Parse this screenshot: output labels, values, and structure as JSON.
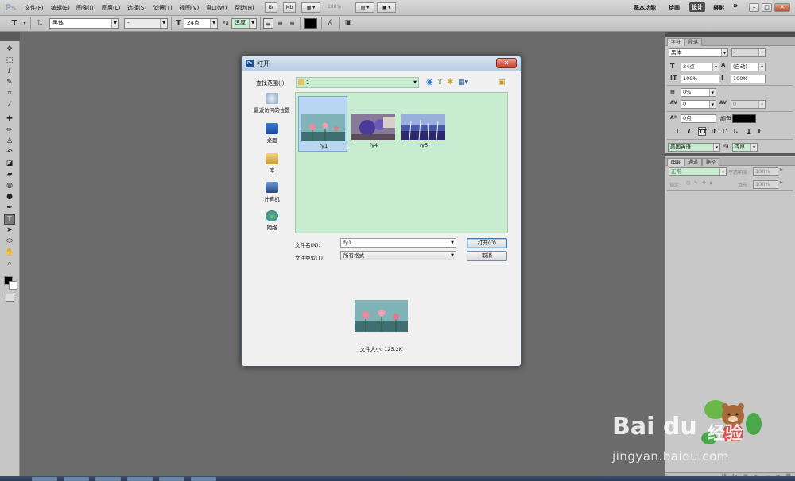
{
  "app": {
    "logo_text": "Ps"
  },
  "menubar": {
    "items": [
      "文件(F)",
      "编辑(E)",
      "图像(I)",
      "图层(L)",
      "选择(S)",
      "滤镜(T)",
      "视图(V)",
      "窗口(W)",
      "帮助(H)"
    ],
    "br_button": "Br",
    "mb_button": "Mb",
    "zoom": "100%",
    "workspaces": [
      "基本功能",
      "绘画",
      "设计",
      "摄影"
    ],
    "active_workspace": "设计",
    "more": "»"
  },
  "options_bar": {
    "tool_icon": "T",
    "font_family": "黑体",
    "font_style": "-",
    "font_size": "24点",
    "aa_label": "ªa",
    "antialias": "浑厚",
    "text_color": "#000000"
  },
  "dialog": {
    "title": "打开",
    "lookin_label": "查找范围(I):",
    "lookin_value": "1",
    "places": [
      {
        "label": "最近访问的位置"
      },
      {
        "label": "桌面"
      },
      {
        "label": "库"
      },
      {
        "label": "计算机"
      },
      {
        "label": "网络"
      }
    ],
    "files": [
      {
        "name": "fy1",
        "selected": true
      },
      {
        "name": "fy4",
        "selected": false
      },
      {
        "name": "fy5",
        "selected": false
      }
    ],
    "filename_label": "文件名(N):",
    "filename_value": "fy1",
    "filetype_label": "文件类型(T):",
    "filetype_value": "所有格式",
    "open_button": "打开(O)",
    "cancel_button": "取消",
    "file_size": "文件大小: 125.2K"
  },
  "char_panel": {
    "tabs": [
      "字符",
      "段落"
    ],
    "font_family": "黑体",
    "font_style": "-",
    "font_size": "24点",
    "leading": "(自动)",
    "vertical_scale": "100%",
    "horizontal_scale": "100%",
    "tsume": "0%",
    "kerning": "0",
    "tracking": "0",
    "baseline_shift": "0点",
    "color_label": "颜色:",
    "language": "美国英语",
    "aa_label": "ªa",
    "antialias": "浑厚",
    "text_buttons": [
      "T",
      "T",
      "TT",
      "Tr",
      "T'",
      "T,",
      "T",
      "Ŧ"
    ]
  },
  "layers_panel": {
    "tabs": [
      "图层",
      "通道",
      "路径"
    ],
    "blend_mode": "正常",
    "opacity_label": "不透明度:",
    "opacity_value": "100%",
    "lock_label": "锁定:",
    "fill_label": "填充:",
    "fill_value": "100%"
  },
  "watermark": {
    "logo": "Bai du",
    "product": "经验",
    "url": "jingyan.baidu.com"
  }
}
